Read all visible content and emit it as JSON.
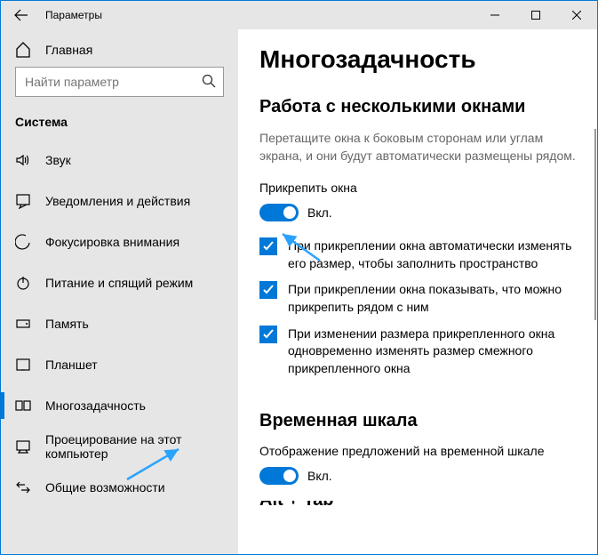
{
  "titlebar": {
    "title": "Параметры"
  },
  "sidebar": {
    "home": "Главная",
    "search_placeholder": "Найти параметр",
    "group_heading": "Система",
    "items": [
      {
        "label": "Звук"
      },
      {
        "label": "Уведомления и действия"
      },
      {
        "label": "Фокусировка внимания"
      },
      {
        "label": "Питание и спящий режим"
      },
      {
        "label": "Память"
      },
      {
        "label": "Планшет"
      },
      {
        "label": "Многозадачность"
      },
      {
        "label": "Проецирование на этот компьютер"
      },
      {
        "label": "Общие возможности"
      }
    ]
  },
  "main": {
    "h1": "Многозадачность",
    "sec1": {
      "h2": "Работа с несколькими окнами",
      "hint": "Перетащите окна к боковым сторонам или углам экрана, и они будут автоматически размещены рядом.",
      "toggle_label": "Прикрепить окна",
      "toggle_state": "Вкл.",
      "chk1": "При прикреплении окна автоматически изменять его размер, чтобы заполнить пространство",
      "chk2": "При прикреплении окна показывать, что можно прикрепить рядом с ним",
      "chk3": "При изменении размера прикрепленного окна одновременно изменять размер смежного прикрепленного окна"
    },
    "sec2": {
      "h2": "Временная шкала",
      "toggle_label": "Отображение предложений на временной шкале",
      "toggle_state": "Вкл."
    },
    "sec3": {
      "h2": "Alt + Tab"
    }
  }
}
